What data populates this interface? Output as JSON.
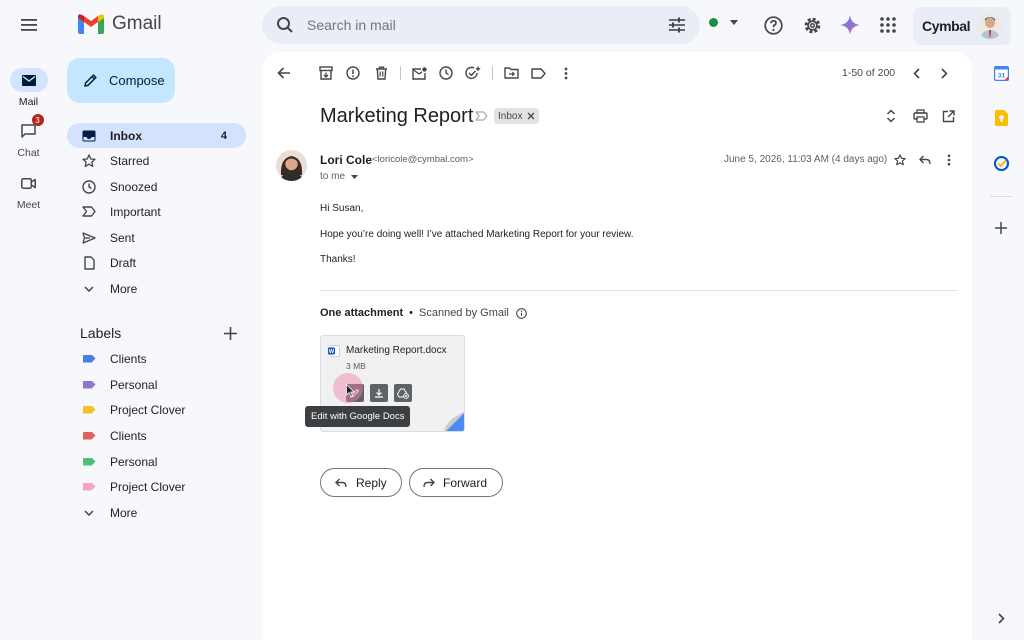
{
  "app": {
    "name": "Gmail",
    "brand_name": "Cymbal"
  },
  "search": {
    "placeholder": "Search in mail"
  },
  "compose": {
    "label": "Compose"
  },
  "rail": [
    {
      "label": "Mail",
      "icon": "mail-icon"
    },
    {
      "label": "Chat",
      "icon": "chat-icon",
      "badge": "3"
    },
    {
      "label": "Meet",
      "icon": "video-icon"
    }
  ],
  "nav": {
    "inbox": {
      "label": "Inbox",
      "count": "4"
    },
    "starred": "Starred",
    "snoozed": "Snoozed",
    "important": "Important",
    "sent": "Sent",
    "draft": "Draft",
    "more": "More"
  },
  "labels": {
    "title": "Labels",
    "items": [
      {
        "label": "Clients",
        "color": "#4a7fe0"
      },
      {
        "label": "Personal",
        "color": "#8e75d6"
      },
      {
        "label": "Project Clover",
        "color": "#f6c026"
      },
      {
        "label": "Clients",
        "color": "#e0605a"
      },
      {
        "label": "Personal",
        "color": "#4fbf75"
      },
      {
        "label": "Project Clover",
        "color": "#f3a7c5"
      }
    ],
    "more": "More"
  },
  "pagination": {
    "range": "1-50 of 200"
  },
  "email": {
    "subject": "Marketing Report",
    "folder_chip": "Inbox",
    "sender_name": "Lori Cole",
    "sender_email": "<loricole@cymbal.com>",
    "recipient": "to me",
    "date": "June 5, 2026, 11:03 AM (4 days ago)",
    "body": [
      "Hi Susan,",
      "Hope you’re doing well! I’ve attached Marketing Report for your review.",
      "Thanks!"
    ]
  },
  "attachments": {
    "summary": "One attachment",
    "scan_note": "Scanned by Gmail",
    "file_name": "Marketing Report.docx",
    "file_size": "3 MB",
    "tooltip": "Edit with Google Docs"
  },
  "actions": {
    "reply": "Reply",
    "forward": "Forward"
  },
  "colors": {
    "accent": "#0b57d0",
    "active_nav": "#d3e3fd",
    "compose_bg": "#c2e7ff",
    "status_online": "#1e8e3e"
  }
}
